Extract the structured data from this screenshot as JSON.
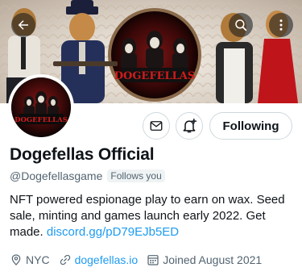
{
  "banner": {
    "title_text": "DOGEFELLAS"
  },
  "avatar": {
    "title_text": "DOGEFELLAS"
  },
  "actions": {
    "follow_label": "Following"
  },
  "profile": {
    "display_name": "Dogefellas Official",
    "handle": "@Dogefellasgame",
    "follows_you": "Follows you",
    "bio_text": "NFT powered espionage play to earn on wax. Seed sale, minting and games launch early 2022. Get made.",
    "bio_link": "discord.gg/pD79EJb5ED"
  },
  "meta": {
    "location": "NYC",
    "website": "dogefellas.io",
    "joined": "Joined August 2021"
  },
  "icons": {
    "back": "arrow-left-icon",
    "search": "search-icon",
    "more": "more-vertical-icon",
    "message": "envelope-icon",
    "notify": "bell-plus-icon",
    "location": "map-pin-icon",
    "website": "link-icon",
    "joined": "calendar-icon"
  },
  "colors": {
    "accent": "#1d9bf0",
    "text": "#0f1419",
    "secondary_text": "#536471"
  }
}
